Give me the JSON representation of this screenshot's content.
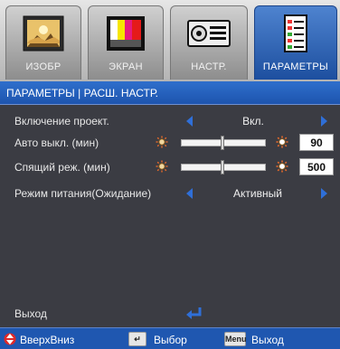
{
  "tabs": [
    {
      "label": "ИЗОБР",
      "icon": "image-icon",
      "active": false
    },
    {
      "label": "ЭКРАН",
      "icon": "color-bars-icon",
      "active": false
    },
    {
      "label": "НАСТР.",
      "icon": "projector-icon",
      "active": false
    },
    {
      "label": "ПАРАМЕТРЫ",
      "icon": "checklist-icon",
      "active": true
    }
  ],
  "breadcrumb": "ПАРАМЕТРЫ | РАСШ. НАСТР.",
  "rows": [
    {
      "label": "Включение проект.",
      "value": "Вкл."
    },
    {
      "label": "Авто выкл. (мин)",
      "value": "90",
      "level": 0.5
    },
    {
      "label": "Спящий реж. (мин)",
      "value": "500",
      "level": 0.5
    },
    {
      "label": "Режим питания(Ожидание)",
      "value": "Активный"
    }
  ],
  "exit": {
    "label": "Выход"
  },
  "footer": {
    "updown": "ВверхВниз",
    "select": "Выбор",
    "menu_key": "Menu",
    "exit": "Выход"
  },
  "colors": {
    "accent": "#1f57b0",
    "arrow": "#2f6fd8"
  }
}
